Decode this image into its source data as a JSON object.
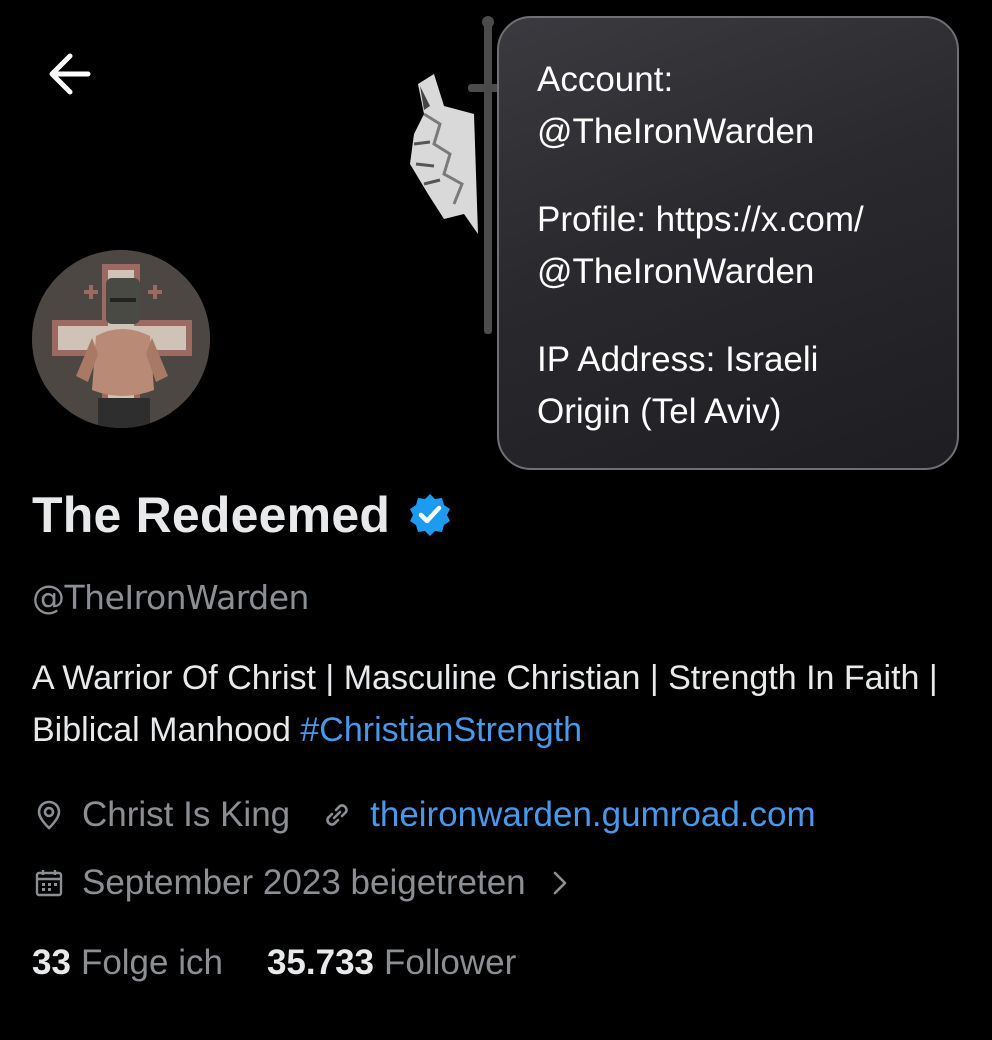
{
  "nav": {
    "back_icon": "arrow-left-icon"
  },
  "info_popup": {
    "account_line1": "Account:",
    "account_line2": "@TheIronWarden",
    "profile_line1": "Profile: https://x.com/",
    "profile_line2": "@TheIronWarden",
    "ip_line1": "IP Address: Israeli",
    "ip_line2": "Origin (Tel Aviv)"
  },
  "profile": {
    "display_name": "The Redeemed",
    "verified_icon": "verified-badge-icon",
    "handle": "@TheIronWarden",
    "bio_text": "A Warrior Of Christ | Masculine Christian | Strength In Faith | Biblical Manhood ",
    "bio_hashtag": "#ChristianStrength",
    "location": "Christ Is King",
    "website": "theironwarden.gumroad.com",
    "joined": "September 2023 beigetreten",
    "following_count": "33",
    "following_label": "Folge ich",
    "followers_count": "35.733",
    "followers_label": "Follower"
  },
  "colors": {
    "background": "#000000",
    "text_primary": "#e7e9ea",
    "text_secondary": "#8b8f94",
    "link": "#4a99e9",
    "verified": "#1d9bf0"
  }
}
